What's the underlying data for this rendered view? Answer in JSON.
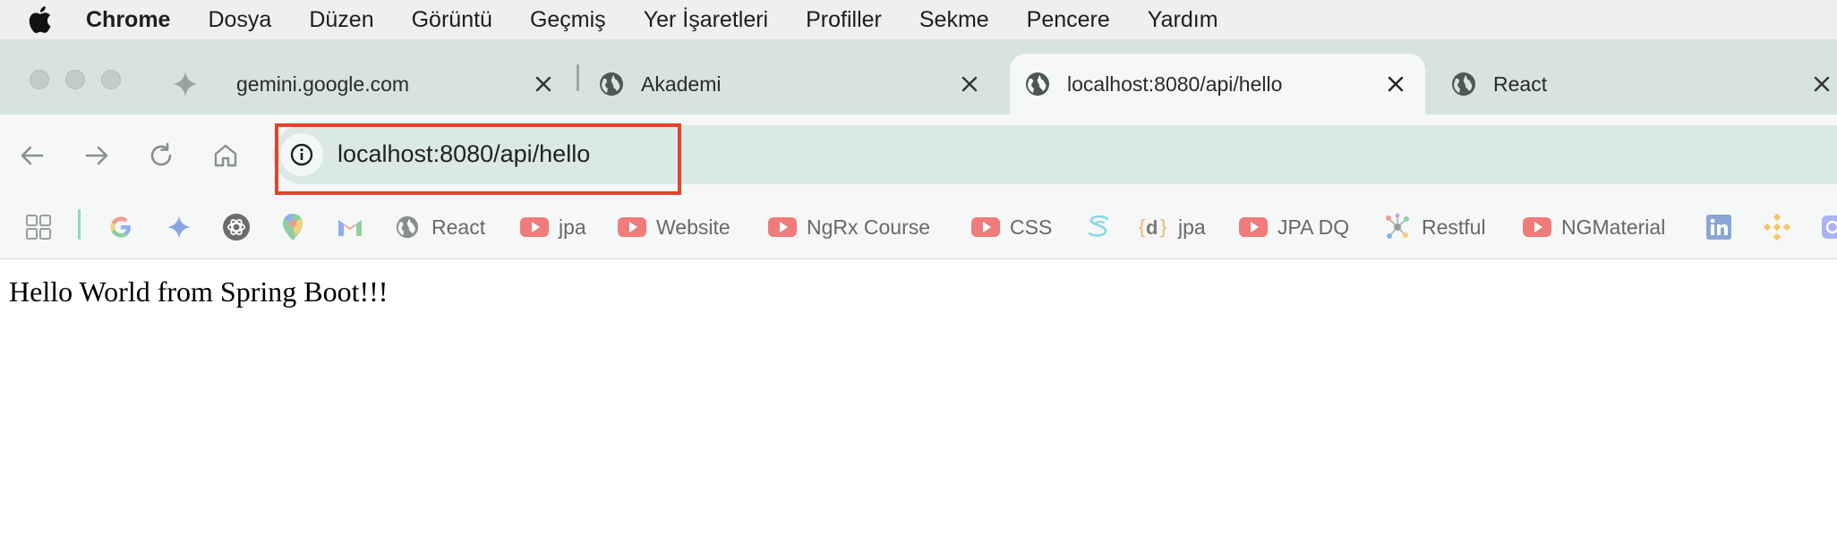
{
  "menubar": {
    "app_name": "Chrome",
    "items": [
      "Dosya",
      "Düzen",
      "Görüntü",
      "Geçmiş",
      "Yer İşaretleri",
      "Profiller",
      "Sekme",
      "Pencere",
      "Yardım"
    ]
  },
  "tabs": [
    {
      "title": "gemini.google.com",
      "icon": "gemini-sparkle-icon",
      "active": false
    },
    {
      "title": "Akademi",
      "icon": "globe-icon",
      "active": false
    },
    {
      "title": "localhost:8080/api/hello",
      "icon": "globe-icon",
      "active": true
    },
    {
      "title": "React",
      "icon": "globe-icon",
      "active": false
    }
  ],
  "toolbar": {
    "url": "localhost:8080/api/hello",
    "highlight_color": "#e2442b"
  },
  "bookmarks": {
    "items": [
      {
        "label": "",
        "icon": "apps-grid-icon"
      },
      {
        "label": "",
        "icon": "google-icon"
      },
      {
        "label": "",
        "icon": "gemini-icon"
      },
      {
        "label": "",
        "icon": "openai-icon"
      },
      {
        "label": "",
        "icon": "google-maps-icon"
      },
      {
        "label": "",
        "icon": "gmail-icon"
      },
      {
        "label": "React",
        "icon": "globe-icon"
      },
      {
        "label": "jpa",
        "icon": "youtube-icon"
      },
      {
        "label": "Website",
        "icon": "youtube-icon"
      },
      {
        "label": "NgRx Course",
        "icon": "youtube-icon"
      },
      {
        "label": "CSS",
        "icon": "youtube-icon"
      },
      {
        "label": "",
        "icon": "stackblitz-icon"
      },
      {
        "label": "jpa",
        "icon": "dev-d-icon"
      },
      {
        "label": "JPA DQ",
        "icon": "youtube-icon"
      },
      {
        "label": "Restful",
        "icon": "graph-icon"
      },
      {
        "label": "NGMaterial",
        "icon": "youtube-icon"
      },
      {
        "label": "",
        "icon": "linkedin-icon"
      },
      {
        "label": "",
        "icon": "binance-icon"
      },
      {
        "label": "",
        "icon": "partial-icon"
      }
    ]
  },
  "page": {
    "body_text": "Hello World from Spring Boot!!!"
  }
}
